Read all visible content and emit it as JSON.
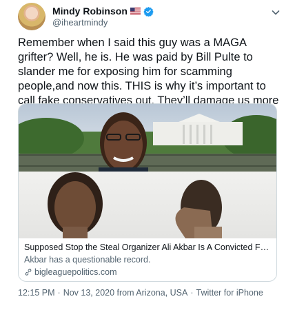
{
  "author": {
    "display_name": "Mindy Robinson",
    "handle": "@iheartmindy",
    "flag_emoji": "us-flag",
    "verified": true
  },
  "tweet": {
    "text": "Remember when I said this guy was a MAGA grifter? Well, he is. He was paid by Bill Pulte to slander me for exposing him for scamming people,and now this. THIS is why it’s important to call fake conservatives out. They’ll damage us more than any leftist."
  },
  "card": {
    "title": "Supposed Stop the Steal Organizer Ali Akbar Is A Convicted Fraudster, Acc...",
    "description": "Akbar has a questionable record.",
    "domain": "bigleaguepolitics.com"
  },
  "meta": {
    "time": "12:15 PM",
    "separator": "·",
    "date": "Nov 13, 2020 from Arizona, USA",
    "separator2": "·",
    "source": "Twitter for iPhone"
  },
  "colors": {
    "verified": "#1d9bf0",
    "text": "#0f1419",
    "secondary": "#536471",
    "border": "#cfd9de"
  }
}
